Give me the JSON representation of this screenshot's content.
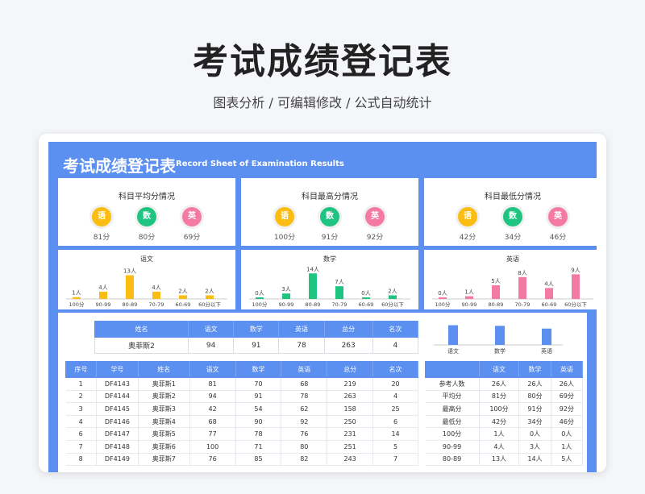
{
  "header": {
    "title": "考试成绩登记表",
    "subtitle": "图表分析 /  可编辑修改  /  公式自动统计"
  },
  "sheet": {
    "title": "考试成绩登记表",
    "subtitle": "Record Sheet of Examination Results"
  },
  "colors": {
    "accent": "#5b8ff0",
    "chinese": "#fbbd12",
    "math": "#1ec47f",
    "english": "#f47aa4"
  },
  "summary": [
    {
      "title": "科目平均分情况",
      "values": [
        "81分",
        "80分",
        "69分"
      ]
    },
    {
      "title": "科目最高分情况",
      "values": [
        "100分",
        "91分",
        "92分"
      ]
    },
    {
      "title": "科目最低分情况",
      "values": [
        "42分",
        "34分",
        "46分"
      ]
    }
  ],
  "subjects_short": [
    "语",
    "数",
    "英"
  ],
  "chart_data": [
    {
      "type": "bar",
      "title": "语文",
      "categories": [
        "100分",
        "90-99",
        "80-89",
        "70-79",
        "60-69",
        "60分以下"
      ],
      "values": [
        1,
        4,
        13,
        4,
        2,
        2
      ],
      "labels": [
        "1人",
        "4人",
        "13人",
        "4人",
        "2人",
        "2人"
      ],
      "ylim": [
        0,
        15
      ]
    },
    {
      "type": "bar",
      "title": "数学",
      "categories": [
        "100分",
        "90-99",
        "80-89",
        "70-79",
        "60-69",
        "60分以下"
      ],
      "values": [
        0,
        3,
        14,
        7,
        0,
        2
      ],
      "labels": [
        "0人",
        "3人",
        "14人",
        "7人",
        "0人",
        "2人"
      ],
      "ylim": [
        0,
        15
      ]
    },
    {
      "type": "bar",
      "title": "英语",
      "categories": [
        "100分",
        "90-99",
        "80-89",
        "70-79",
        "60-69",
        "60分以下"
      ],
      "values": [
        0,
        1,
        5,
        8,
        4,
        9
      ],
      "labels": [
        "0人",
        "1人",
        "5人",
        "8人",
        "4人",
        "9人"
      ],
      "ylim": [
        0,
        10
      ]
    },
    {
      "type": "bar",
      "title": "",
      "categories": [
        "语文",
        "数学",
        "英语"
      ],
      "values": [
        94,
        91,
        78
      ],
      "ylim": [
        0,
        100
      ]
    }
  ],
  "lookup": {
    "headers": [
      "姓名",
      "语文",
      "数学",
      "英语",
      "总分",
      "名次"
    ],
    "values": [
      "奥菲斯2",
      "94",
      "91",
      "78",
      "263",
      "4"
    ]
  },
  "main_table": {
    "headers": [
      "序号",
      "学号",
      "姓名",
      "语文",
      "数学",
      "英语",
      "总分",
      "名次"
    ],
    "rows": [
      [
        "1",
        "DF4143",
        "奥菲斯1",
        "81",
        "70",
        "68",
        "219",
        "20"
      ],
      [
        "2",
        "DF4144",
        "奥菲斯2",
        "94",
        "91",
        "78",
        "263",
        "4"
      ],
      [
        "3",
        "DF4145",
        "奥菲斯3",
        "42",
        "54",
        "62",
        "158",
        "25"
      ],
      [
        "4",
        "DF4146",
        "奥菲斯4",
        "68",
        "90",
        "92",
        "250",
        "6"
      ],
      [
        "6",
        "DF4147",
        "奥菲斯5",
        "77",
        "78",
        "76",
        "231",
        "14"
      ],
      [
        "7",
        "DF4148",
        "奥菲斯6",
        "100",
        "71",
        "80",
        "251",
        "5"
      ],
      [
        "8",
        "DF4149",
        "奥菲斯7",
        "76",
        "85",
        "82",
        "243",
        "7"
      ]
    ]
  },
  "stats_table": {
    "headers": [
      "",
      "语文",
      "数学",
      "英语"
    ],
    "rows": [
      [
        "参考人数",
        "26人",
        "26人",
        "26人"
      ],
      [
        "平均分",
        "81分",
        "80分",
        "69分"
      ],
      [
        "最高分",
        "100分",
        "91分",
        "92分"
      ],
      [
        "最低分",
        "42分",
        "34分",
        "46分"
      ],
      [
        "100分",
        "1人",
        "0人",
        "0人"
      ],
      [
        "90-99",
        "4人",
        "3人",
        "1人"
      ],
      [
        "80-89",
        "13人",
        "14人",
        "5人"
      ]
    ]
  }
}
